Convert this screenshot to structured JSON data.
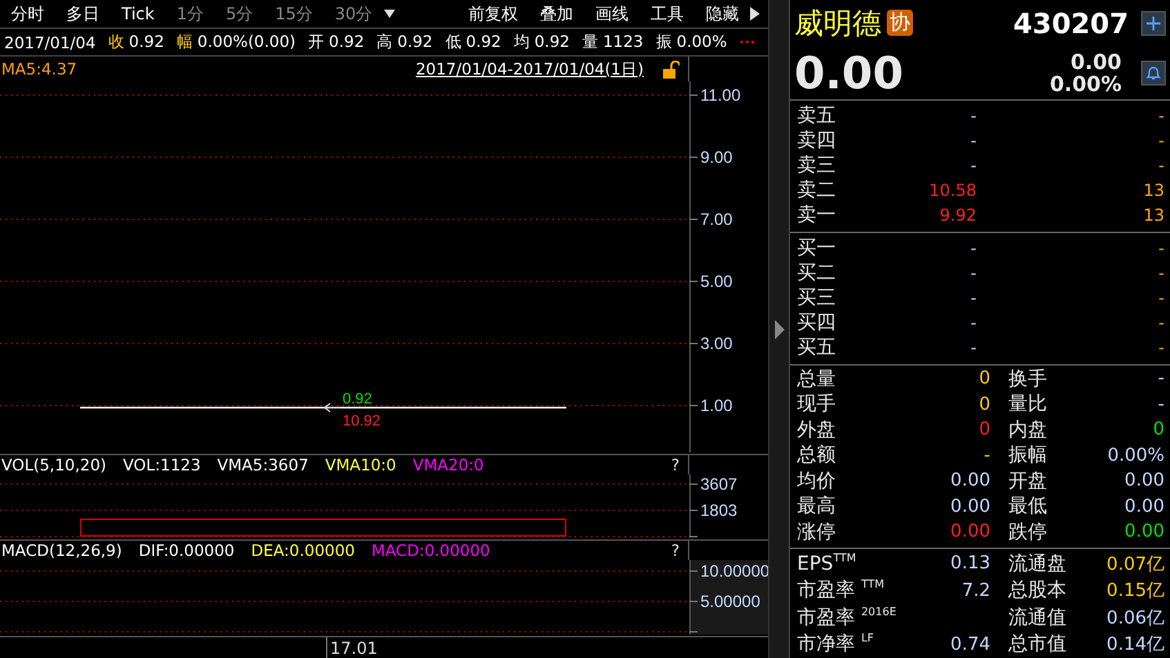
{
  "toolbar": {
    "periods": [
      {
        "label": "分时",
        "disabled": false
      },
      {
        "label": "多日",
        "disabled": false
      },
      {
        "label": "Tick",
        "disabled": false
      },
      {
        "label": "1分",
        "disabled": true
      },
      {
        "label": "5分",
        "disabled": true
      },
      {
        "label": "15分",
        "disabled": true
      },
      {
        "label": "30分",
        "disabled": true
      }
    ],
    "tools": [
      "前复权",
      "叠加",
      "画线",
      "工具",
      "隐藏"
    ]
  },
  "quote_bar": {
    "date": "2017/01/04",
    "fields": [
      {
        "label": "收",
        "value": "0.92",
        "highlight": true
      },
      {
        "label": "幅",
        "value": "0.00%(0.00)",
        "highlight": true
      },
      {
        "label": "开",
        "value": "0.92",
        "highlight": false
      },
      {
        "label": "高",
        "value": "0.92",
        "highlight": false
      },
      {
        "label": "低",
        "value": "0.92",
        "highlight": false
      },
      {
        "label": "均",
        "value": "0.92",
        "highlight": false
      },
      {
        "label": "量",
        "value": "1123",
        "highlight": false
      },
      {
        "label": "振",
        "value": "0.00%",
        "highlight": false
      }
    ]
  },
  "price_chart": {
    "ma": "MA5:4.37",
    "range": "2017/01/04-2017/01/04(1日)",
    "axis": [
      "11.00",
      "9.00",
      "7.00",
      "5.00",
      "3.00",
      "1.00"
    ],
    "marker_labels": [
      {
        "text": "0.92",
        "color": "#00e000"
      },
      {
        "text": "10.92",
        "color": "#ff2020"
      }
    ]
  },
  "volume_chart": {
    "legend": [
      {
        "text": "VOL(5,10,20)",
        "color": "#ffffff"
      },
      {
        "text": "VOL:1123",
        "color": "#ffffff"
      },
      {
        "text": "VMA5:3607",
        "color": "#ffffff"
      },
      {
        "text": "VMA10:0",
        "color": "#ffff40"
      },
      {
        "text": "VMA20:0",
        "color": "#ff00ff"
      }
    ],
    "help": "?",
    "axis": [
      "3607",
      "1803"
    ]
  },
  "macd_chart": {
    "legend": [
      {
        "text": "MACD(12,26,9)",
        "color": "#ffffff"
      },
      {
        "text": "DIF:0.00000",
        "color": "#ffffff"
      },
      {
        "text": "DEA:0.00000",
        "color": "#ffff40"
      },
      {
        "text": "MACD:0.00000",
        "color": "#ff00ff"
      }
    ],
    "help": "?",
    "axis": [
      "10.00000",
      "5.00000"
    ]
  },
  "time_axis": [
    "17.01"
  ],
  "stock": {
    "name": "威明德",
    "badge": "协",
    "code": "430207",
    "price": "0.00",
    "change": "0.00",
    "change_pct": "0.00%"
  },
  "sell_orders": [
    {
      "label": "卖五",
      "price": "-",
      "volume": "-",
      "color": "#c0d8ff"
    },
    {
      "label": "卖四",
      "price": "-",
      "volume": "-",
      "color": "#c0d8ff"
    },
    {
      "label": "卖三",
      "price": "-",
      "volume": "-",
      "color": "#c0d8ff"
    },
    {
      "label": "卖二",
      "price": "10.58",
      "volume": "13",
      "color": "#ff2020"
    },
    {
      "label": "卖一",
      "price": "9.92",
      "volume": "13",
      "color": "#ff2020"
    }
  ],
  "buy_orders": [
    {
      "label": "买一",
      "price": "-",
      "volume": "-",
      "color": "#c0d8ff"
    },
    {
      "label": "买二",
      "price": "-",
      "volume": "-",
      "color": "#c0d8ff"
    },
    {
      "label": "买三",
      "price": "-",
      "volume": "-",
      "color": "#c0d8ff"
    },
    {
      "label": "买四",
      "price": "-",
      "volume": "-",
      "color": "#c0d8ff"
    },
    {
      "label": "买五",
      "price": "-",
      "volume": "-",
      "color": "#c0d8ff"
    }
  ],
  "stats": [
    {
      "label": "总量",
      "value": "0",
      "color": "#ffcc00"
    },
    {
      "label": "换手",
      "value": "-",
      "color": "#c0d8ff"
    },
    {
      "label": "现手",
      "value": "0",
      "color": "#ffcc00"
    },
    {
      "label": "量比",
      "value": "-",
      "color": "#c0d8ff"
    },
    {
      "label": "外盘",
      "value": "0",
      "color": "#ff2020"
    },
    {
      "label": "内盘",
      "value": "0",
      "color": "#00e000"
    },
    {
      "label": "总额",
      "value": "-",
      "color": "#ffcc00"
    },
    {
      "label": "振幅",
      "value": "0.00%",
      "color": "#c0d8ff"
    },
    {
      "label": "均价",
      "value": "0.00",
      "color": "#c0d8ff"
    },
    {
      "label": "开盘",
      "value": "0.00",
      "color": "#c0d8ff"
    },
    {
      "label": "最高",
      "value": "0.00",
      "color": "#c0d8ff"
    },
    {
      "label": "最低",
      "value": "0.00",
      "color": "#c0d8ff"
    },
    {
      "label": "涨停",
      "value": "0.00",
      "color": "#ff2020"
    },
    {
      "label": "跌停",
      "value": "0.00",
      "color": "#00e000"
    }
  ],
  "fundamentals": [
    {
      "label": "EPS$^{TTM}$",
      "value": "0.13",
      "color": "#c0d8ff"
    },
    {
      "label": "流通盘",
      "value": "0.07亿",
      "color": "#ffcc00"
    },
    {
      "label": "市盈率 $^{TTM}$",
      "value": "7.2",
      "color": "#c0d8ff"
    },
    {
      "label": "总股本",
      "value": "0.15亿",
      "color": "#ffcc00"
    },
    {
      "label": "市盈率 $^{2016E}$"
    },
    {
      "label": "流通值",
      "value": "0.06亿",
      "color": "#c0d8ff"
    },
    {
      "label": "市净率 $^{LF}$",
      "value": "0.74",
      "color": "#c0d8ff"
    },
    {
      "label": "总市值",
      "value": "0.14亿",
      "color": "#c0d8ff"
    }
  ]
}
